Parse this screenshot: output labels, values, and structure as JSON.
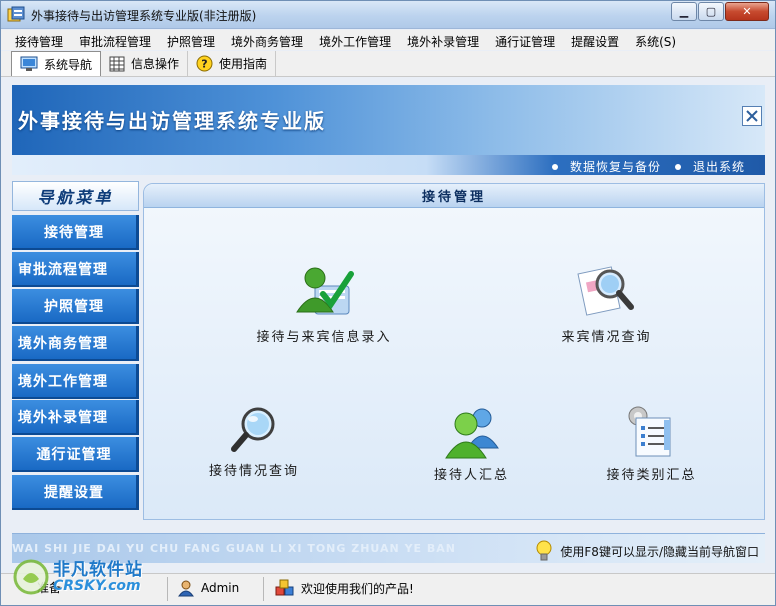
{
  "window": {
    "title": "外事接待与出访管理系统专业版(非注册版)"
  },
  "menu": {
    "items": [
      "接待管理",
      "审批流程管理",
      "护照管理",
      "境外商务管理",
      "境外工作管理",
      "境外补录管理",
      "通行证管理",
      "提醒设置",
      "系统(S)"
    ]
  },
  "toolbar": {
    "tabs": [
      {
        "label": "系统导航",
        "icon": "monitor-icon",
        "active": true
      },
      {
        "label": "信息操作",
        "icon": "grid-icon",
        "active": false
      },
      {
        "label": "使用指南",
        "icon": "help-icon",
        "active": false
      }
    ]
  },
  "banner": {
    "title": "外事接待与出访管理系统专业版",
    "links": [
      "数据恢复与备份",
      "退出系统"
    ]
  },
  "nav": {
    "header": "导航菜单",
    "items": [
      "接待管理",
      "审批流程管理",
      "护照管理",
      "境外商务管理",
      "境外工作管理",
      "境外补录管理",
      "通行证管理",
      "提醒设置"
    ]
  },
  "content": {
    "title": "接待管理",
    "features": [
      {
        "label": "接待与来宾信息录入",
        "icon": "user-check-icon"
      },
      {
        "label": "来宾情况查询",
        "icon": "search-document-icon"
      },
      {
        "label": "接待情况查询",
        "icon": "magnifier-icon"
      },
      {
        "label": "接待人汇总",
        "icon": "users-group-icon"
      },
      {
        "label": "接待类别汇总",
        "icon": "category-list-icon"
      }
    ]
  },
  "footer": {
    "pinyin": "WAI SHI JIE DAI YU CHU FANG GUAN LI XI TONG ZHUAN YE BAN",
    "hint": "使用F8键可以显示/隐藏当前导航窗口"
  },
  "statusbar": {
    "status": "准备",
    "user": "Admin",
    "welcome": "欢迎使用我们的产品!"
  },
  "watermark": {
    "line1": "非凡软件站",
    "line2": "CRSKY.com"
  },
  "colors": {
    "accent": "#1969c4",
    "banner_dark": "#1f66b9",
    "panel": "#dbe9f8"
  }
}
